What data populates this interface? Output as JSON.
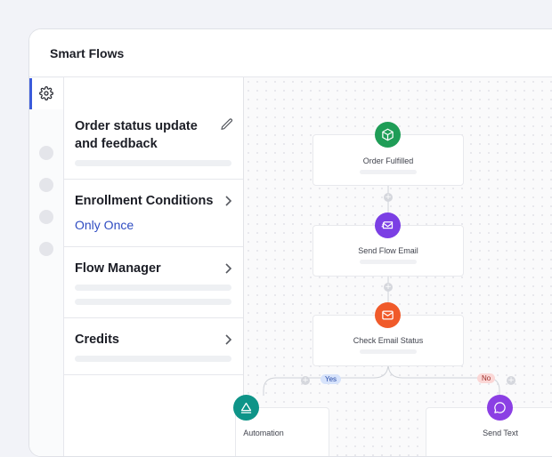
{
  "app": {
    "title": "Smart Flows"
  },
  "rail": {
    "items": [
      "settings-icon",
      "",
      "",
      "",
      ""
    ]
  },
  "panel": {
    "flow_title_line1": "Order status update",
    "flow_title_line2": "and feedback",
    "enrollment": {
      "label": "Enrollment Conditions",
      "value": "Only Once"
    },
    "flow_manager": {
      "label": "Flow Manager"
    },
    "credits": {
      "label": "Credits"
    }
  },
  "flow": {
    "nodes": [
      {
        "label": "Order Fulfilled",
        "icon": "package-icon",
        "color": "#1f9d57"
      },
      {
        "label": "Send Flow Email",
        "icon": "email-send-icon",
        "color": "#7b3fe4"
      },
      {
        "label": "Check Email Status",
        "icon": "mail-icon",
        "color": "#f05a2a"
      },
      {
        "label": "Automation",
        "icon": "triangle-icon",
        "color": "#0e9488"
      },
      {
        "label": "Send Text",
        "icon": "chat-icon",
        "color": "#8b3fe4"
      }
    ],
    "branches": {
      "yes": "Yes",
      "no": "No"
    }
  }
}
